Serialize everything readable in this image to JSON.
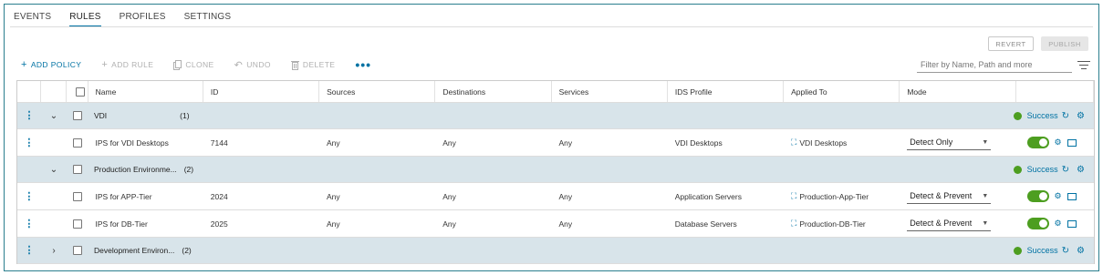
{
  "tabs": [
    "EVENTS",
    "RULES",
    "PROFILES",
    "SETTINGS"
  ],
  "active_tab": "RULES",
  "top_buttons": {
    "revert": "REVERT",
    "publish": "PUBLISH"
  },
  "toolbar": {
    "add_policy": "ADD POLICY",
    "add_rule": "ADD RULE",
    "clone": "CLONE",
    "undo": "UNDO",
    "delete": "DELETE",
    "more": "•••"
  },
  "filter": {
    "placeholder": "Filter by Name, Path and more"
  },
  "columns": [
    "Name",
    "ID",
    "Sources",
    "Destinations",
    "Services",
    "IDS Profile",
    "Applied To",
    "Mode"
  ],
  "sections": [
    {
      "name": "VDI",
      "count": "(1)",
      "status": "Success",
      "expanded": true,
      "rules": [
        {
          "name": "IPS for VDI Desktops",
          "id": "7144",
          "sources": "Any",
          "destinations": "Any",
          "services": "Any",
          "ids_profile": "VDI Desktops",
          "applied_to": "VDI Desktops",
          "mode": "Detect Only"
        }
      ]
    },
    {
      "name": "Production Environme...",
      "count": "(2)",
      "status": "Success",
      "expanded": true,
      "rules": [
        {
          "name": "IPS for APP-Tier",
          "id": "2024",
          "sources": "Any",
          "destinations": "Any",
          "services": "Any",
          "ids_profile": "Application Servers",
          "applied_to": "Production-App-Tier",
          "mode": "Detect & Prevent"
        },
        {
          "name": "IPS for DB-Tier",
          "id": "2025",
          "sources": "Any",
          "destinations": "Any",
          "services": "Any",
          "ids_profile": "Database Servers",
          "applied_to": "Production-DB-Tier",
          "mode": "Detect & Prevent"
        }
      ]
    },
    {
      "name": "Development Environ...",
      "count": "(2)",
      "status": "Success",
      "expanded": false,
      "rules": []
    }
  ],
  "colors": {
    "accent": "#0072a3",
    "success": "#4d9e20",
    "section_bg": "#d8e4ea",
    "frame": "#2a7f8e"
  }
}
